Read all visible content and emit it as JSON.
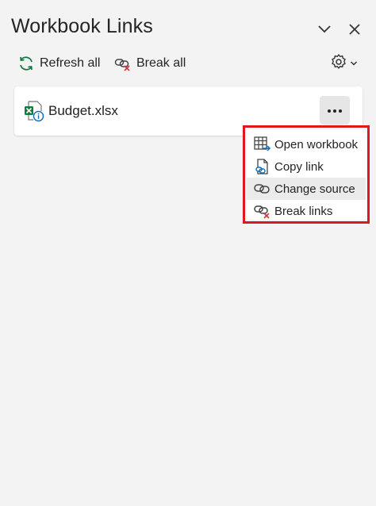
{
  "pane": {
    "title": "Workbook Links",
    "collapse_icon": "chevron-down-icon",
    "close_icon": "close-icon"
  },
  "toolbar": {
    "refresh_all_label": "Refresh all",
    "break_all_label": "Break all",
    "settings_icon": "gear-icon"
  },
  "links": [
    {
      "file_name": "Budget.xlsx",
      "icon": "excel-file-info-icon"
    }
  ],
  "context_menu": {
    "items": [
      {
        "label": "Open workbook",
        "icon": "open-workbook-icon"
      },
      {
        "label": "Copy link",
        "icon": "copy-link-icon"
      },
      {
        "label": "Change source",
        "icon": "change-source-icon"
      },
      {
        "label": "Break links",
        "icon": "break-link-icon"
      }
    ],
    "highlighted_item": "Change source"
  },
  "colors": {
    "excel_green": "#107c41",
    "info_blue": "#0f6cbd",
    "break_red": "#d13438",
    "callout_red": "#e0191e"
  }
}
